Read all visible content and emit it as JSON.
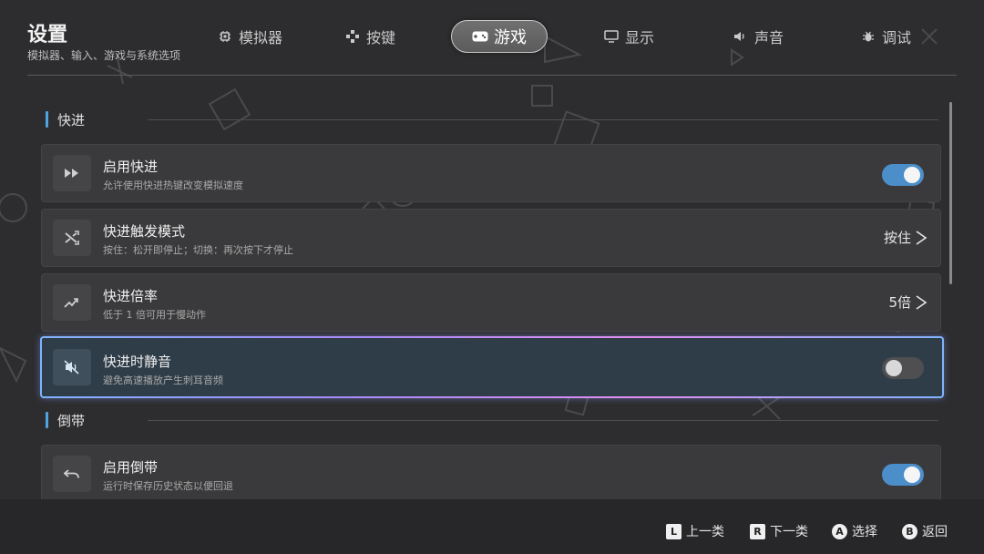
{
  "header": {
    "title": "设置",
    "subtitle": "模拟器、输入、游戏与系统选项"
  },
  "tabs": [
    {
      "label": "模拟器",
      "icon": "chip-icon",
      "active": false
    },
    {
      "label": "按键",
      "icon": "dpad-icon",
      "active": false
    },
    {
      "label": "游戏",
      "icon": "gamepad-icon",
      "active": true
    },
    {
      "label": "显示",
      "icon": "monitor-icon",
      "active": false
    },
    {
      "label": "声音",
      "icon": "speaker-icon",
      "active": false
    },
    {
      "label": "调试",
      "icon": "bug-icon",
      "active": false
    }
  ],
  "sections": [
    {
      "title": "快进",
      "rows": [
        {
          "title": "启用快进",
          "desc": "允许使用快进热键改变模拟速度",
          "icon": "fast-forward-icon",
          "control": "toggle",
          "on": true
        },
        {
          "title": "快进触发模式",
          "desc": "按住：松开即停止；切换：再次按下才停止",
          "icon": "shuffle-icon",
          "control": "value",
          "value": "按住"
        },
        {
          "title": "快进倍率",
          "desc": "低于 1 倍可用于慢动作",
          "icon": "trending-up-icon",
          "control": "value",
          "value": "5倍"
        },
        {
          "title": "快进时静音",
          "desc": "避免高速播放产生刺耳音频",
          "icon": "volume-off-icon",
          "control": "toggle",
          "on": false,
          "focused": true
        }
      ]
    },
    {
      "title": "倒带",
      "rows": [
        {
          "title": "启用倒带",
          "desc": "运行时保存历史状态以便回退",
          "icon": "undo-icon",
          "control": "toggle",
          "on": true
        }
      ]
    }
  ],
  "footer": [
    {
      "key": "L",
      "label": "上一类"
    },
    {
      "key": "R",
      "label": "下一类"
    },
    {
      "key": "A",
      "label": "选择"
    },
    {
      "key": "B",
      "label": "返回"
    }
  ],
  "colors": {
    "accent": "#4fa3e0",
    "toggle_on": "#4c8ec9",
    "background": "#2d2d2f",
    "row": "#3a3a3c"
  }
}
